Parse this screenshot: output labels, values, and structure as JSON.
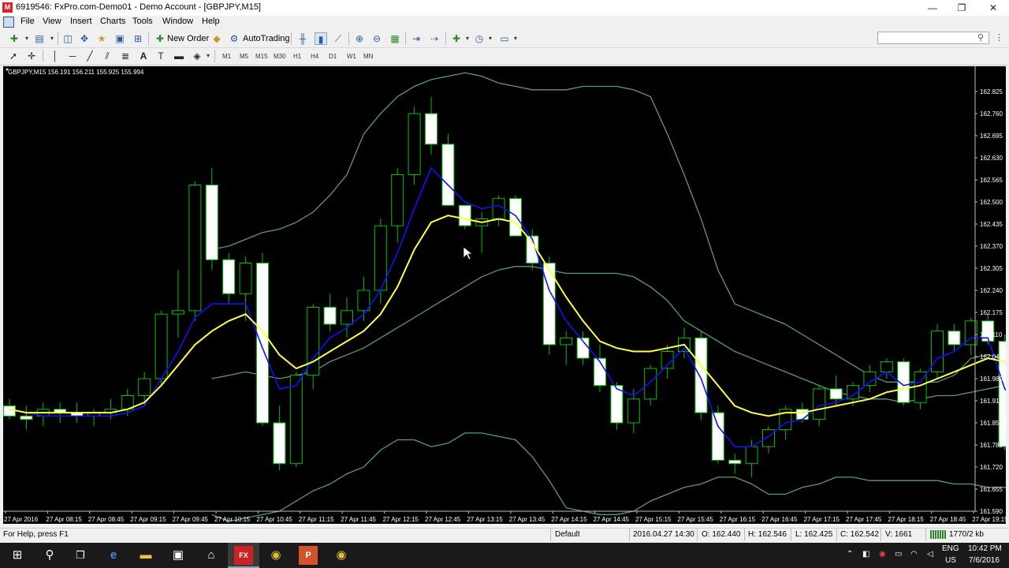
{
  "window": {
    "title": "6919546: FxPro.com-Demo01 - Demo Account - [GBPJPY,M15]",
    "controls": {
      "minimize": "—",
      "restore": "❐",
      "close": "✕"
    }
  },
  "menu": {
    "items": [
      "File",
      "View",
      "Insert",
      "Charts",
      "Tools",
      "Window",
      "Help"
    ]
  },
  "toolbar": {
    "new_order_label": "New Order",
    "autotrading_label": "AutoTrading",
    "search_placeholder": ""
  },
  "timeframes": [
    "M1",
    "M5",
    "M15",
    "M30",
    "H1",
    "H4",
    "D1",
    "W1",
    "MN"
  ],
  "chart": {
    "header": "GBPJPY,M15  156.191 156.211 155.925 155.994",
    "colors": {
      "background": "#000000",
      "bull": "#000000",
      "bear": "#ffffff",
      "wick": "#00c000",
      "ma_fast": "#ffff40",
      "ma_slow": "#1010ff",
      "bands": "#5a9a7a"
    }
  },
  "chart_data": {
    "type": "candlestick",
    "symbol": "GBPJPY",
    "timeframe": "M15",
    "ylim": [
      161.59,
      162.89
    ],
    "price_ticks": [
      "162.825",
      "162.760",
      "162.695",
      "162.630",
      "162.565",
      "162.500",
      "162.435",
      "162.370",
      "162.305",
      "162.240",
      "162.175",
      "162.110",
      "162.045",
      "161.980",
      "161.915",
      "161.850",
      "161.785",
      "161.720",
      "161.655",
      "161.590"
    ],
    "time_labels": [
      "27 Apr 2016",
      "27 Apr 08:15",
      "27 Apr 08:45",
      "27 Apr 09:15",
      "27 Apr 09:45",
      "27 Apr 10:15",
      "27 Apr 10:45",
      "27 Apr 11:15",
      "27 Apr 11:45",
      "27 Apr 12:15",
      "27 Apr 12:45",
      "27 Apr 13:15",
      "27 Apr 13:45",
      "27 Apr 14:15",
      "27 Apr 14:45",
      "27 Apr 15:15",
      "27 Apr 15:45",
      "27 Apr 16:15",
      "27 Apr 16:45",
      "27 Apr 17:15",
      "27 Apr 17:45",
      "27 Apr 18:15",
      "27 Apr 18:45",
      "27 Apr 19:15"
    ],
    "candles": [
      [
        161.9,
        161.92,
        161.86,
        161.87
      ],
      [
        161.87,
        161.9,
        161.83,
        161.86
      ],
      [
        161.87,
        161.91,
        161.84,
        161.89
      ],
      [
        161.89,
        161.91,
        161.85,
        161.88
      ],
      [
        161.88,
        161.91,
        161.85,
        161.87
      ],
      [
        161.87,
        161.89,
        161.84,
        161.88
      ],
      [
        161.88,
        161.92,
        161.86,
        161.89
      ],
      [
        161.89,
        161.95,
        161.87,
        161.93
      ],
      [
        161.93,
        162.0,
        161.9,
        161.98
      ],
      [
        161.98,
        162.18,
        161.96,
        162.17
      ],
      [
        162.17,
        162.3,
        162.1,
        162.18
      ],
      [
        162.18,
        162.56,
        162.15,
        162.55
      ],
      [
        162.55,
        162.6,
        162.3,
        162.33
      ],
      [
        162.33,
        162.35,
        162.2,
        162.23
      ],
      [
        162.23,
        162.34,
        162.15,
        162.32
      ],
      [
        162.32,
        162.35,
        161.84,
        161.85
      ],
      [
        161.85,
        161.9,
        161.71,
        161.73
      ],
      [
        161.73,
        162.0,
        161.72,
        161.99
      ],
      [
        161.99,
        162.2,
        161.95,
        162.19
      ],
      [
        162.19,
        162.23,
        162.12,
        162.14
      ],
      [
        162.14,
        162.22,
        162.1,
        162.18
      ],
      [
        162.18,
        162.28,
        162.15,
        162.24
      ],
      [
        162.24,
        162.45,
        162.2,
        162.43
      ],
      [
        162.43,
        162.6,
        162.38,
        162.58
      ],
      [
        162.58,
        162.78,
        162.55,
        162.76
      ],
      [
        162.76,
        162.81,
        162.64,
        162.67
      ],
      [
        162.67,
        162.7,
        162.5,
        162.49
      ],
      [
        162.49,
        162.49,
        162.42,
        162.43
      ],
      [
        162.43,
        162.47,
        162.35,
        162.45
      ],
      [
        162.45,
        162.52,
        162.43,
        162.51
      ],
      [
        162.51,
        162.52,
        162.4,
        162.4
      ],
      [
        162.4,
        162.42,
        162.3,
        162.32
      ],
      [
        162.32,
        162.34,
        162.05,
        162.08
      ],
      [
        162.08,
        162.12,
        162.02,
        162.1
      ],
      [
        162.1,
        162.12,
        162.02,
        162.04
      ],
      [
        162.04,
        162.08,
        161.94,
        161.96
      ],
      [
        161.96,
        161.97,
        161.83,
        161.85
      ],
      [
        161.85,
        161.95,
        161.82,
        161.92
      ],
      [
        161.92,
        162.02,
        161.9,
        162.01
      ],
      [
        162.01,
        162.08,
        161.98,
        162.06
      ],
      [
        162.06,
        162.13,
        162.04,
        162.1
      ],
      [
        162.1,
        162.12,
        161.86,
        161.88
      ],
      [
        161.88,
        161.9,
        161.73,
        161.74
      ],
      [
        161.74,
        161.76,
        161.7,
        161.73
      ],
      [
        161.73,
        161.8,
        161.69,
        161.78
      ],
      [
        161.78,
        161.84,
        161.76,
        161.83
      ],
      [
        161.83,
        161.9,
        161.8,
        161.89
      ],
      [
        161.89,
        161.91,
        161.85,
        161.86
      ],
      [
        161.86,
        161.96,
        161.84,
        161.95
      ],
      [
        161.95,
        161.99,
        161.9,
        161.92
      ],
      [
        161.92,
        161.97,
        161.9,
        161.96
      ],
      [
        161.96,
        162.02,
        161.94,
        162.0
      ],
      [
        162.0,
        162.04,
        161.98,
        162.03
      ],
      [
        162.03,
        162.04,
        161.9,
        161.91
      ],
      [
        161.91,
        162.01,
        161.89,
        162.0
      ],
      [
        162.0,
        162.14,
        161.98,
        162.12
      ],
      [
        162.12,
        162.14,
        162.06,
        162.08
      ],
      [
        162.08,
        162.16,
        162.05,
        162.15
      ],
      [
        162.15,
        162.17,
        162.08,
        162.09
      ],
      [
        162.09,
        162.11,
        161.77,
        161.78
      ],
      [
        161.78,
        161.88,
        161.76,
        161.87
      ]
    ],
    "ma_fast": [
      161.89,
      161.88,
      161.88,
      161.88,
      161.88,
      161.88,
      161.88,
      161.89,
      161.91,
      161.96,
      162.02,
      162.08,
      162.12,
      162.15,
      162.17,
      162.12,
      162.05,
      162.01,
      162.03,
      162.06,
      162.09,
      162.12,
      162.17,
      162.25,
      162.36,
      162.44,
      162.46,
      162.45,
      162.44,
      162.45,
      162.44,
      162.38,
      162.3,
      162.22,
      162.15,
      162.09,
      162.07,
      162.06,
      162.06,
      162.07,
      162.08,
      162.02,
      161.96,
      161.9,
      161.88,
      161.87,
      161.88,
      161.88,
      161.89,
      161.9,
      161.91,
      161.92,
      161.94,
      161.95,
      161.96,
      161.98,
      162.0,
      162.02,
      162.04,
      162.03,
      161.97
    ],
    "ma_slow": [
      161.89,
      161.88,
      161.87,
      161.87,
      161.87,
      161.87,
      161.87,
      161.88,
      161.9,
      161.98,
      162.06,
      162.16,
      162.2,
      162.2,
      162.2,
      162.07,
      161.95,
      161.96,
      162.04,
      162.1,
      162.13,
      162.17,
      162.24,
      162.35,
      162.48,
      162.6,
      162.55,
      162.5,
      162.48,
      162.49,
      162.46,
      162.39,
      162.24,
      162.15,
      162.09,
      162.03,
      161.95,
      161.93,
      161.97,
      162.02,
      162.07,
      161.98,
      161.84,
      161.78,
      161.78,
      161.81,
      161.85,
      161.86,
      161.9,
      161.91,
      161.93,
      161.97,
      162.0,
      161.96,
      161.97,
      162.04,
      162.06,
      162.1,
      162.1,
      161.95,
      161.9
    ],
    "band_mid": [
      null,
      null,
      null,
      null,
      null,
      null,
      null,
      null,
      null,
      null,
      null,
      null,
      161.98,
      161.99,
      162.0,
      161.99,
      161.98,
      161.99,
      162.0,
      162.03,
      162.05,
      162.07,
      162.1,
      162.13,
      162.16,
      162.19,
      162.22,
      162.25,
      162.28,
      162.3,
      162.31,
      162.31,
      162.3,
      162.29,
      162.29,
      162.29,
      162.29,
      162.28,
      162.25,
      162.21,
      162.15,
      162.12,
      162.09,
      162.06,
      162.04,
      162.02,
      162.0,
      161.98,
      161.96,
      161.94,
      161.93,
      161.92,
      161.92,
      161.91,
      161.92,
      161.93,
      161.93,
      161.94,
      161.95,
      161.96,
      161.95
    ],
    "band_upper": [
      null,
      null,
      null,
      null,
      null,
      null,
      null,
      null,
      null,
      null,
      null,
      null,
      162.36,
      162.37,
      162.39,
      162.41,
      162.42,
      162.44,
      162.47,
      162.52,
      162.58,
      162.7,
      162.76,
      162.81,
      162.84,
      162.86,
      162.87,
      162.88,
      162.87,
      162.85,
      162.84,
      162.83,
      162.83,
      162.83,
      162.84,
      162.84,
      162.84,
      162.83,
      162.81,
      162.7,
      162.58,
      162.45,
      162.3,
      162.2,
      162.18,
      162.16,
      162.14,
      162.11,
      162.08,
      162.05,
      162.02,
      161.99,
      161.97,
      161.97,
      161.97,
      161.97,
      161.99,
      162.04,
      162.05,
      162.04,
      162.01
    ],
    "band_lower": [
      null,
      null,
      null,
      null,
      null,
      null,
      null,
      null,
      null,
      null,
      null,
      null,
      161.58,
      161.56,
      161.57,
      161.58,
      161.59,
      161.62,
      161.65,
      161.67,
      161.7,
      161.72,
      161.77,
      161.8,
      161.8,
      161.78,
      161.79,
      161.82,
      161.82,
      161.81,
      161.8,
      161.75,
      161.68,
      161.6,
      161.59,
      161.58,
      161.58,
      161.59,
      161.62,
      161.64,
      161.66,
      161.67,
      161.69,
      161.69,
      161.67,
      161.64,
      161.64,
      161.66,
      161.67,
      161.69,
      161.69,
      161.68,
      161.68,
      161.68,
      161.68,
      161.68,
      161.67,
      161.67,
      161.66,
      161.66,
      161.66
    ]
  },
  "status": {
    "help": "For Help, press F1",
    "profile": "Default",
    "time": "2016.04.27 14:30",
    "open": "O: 162.440",
    "high": "H: 162.546",
    "low": "L: 162.425",
    "close": "C: 162.542",
    "volume": "V: 1661",
    "traffic": "1770/2 kb"
  },
  "taskbar": {
    "lang": "ENG",
    "region": "US",
    "time": "10:42 PM",
    "date": "7/6/2016"
  }
}
